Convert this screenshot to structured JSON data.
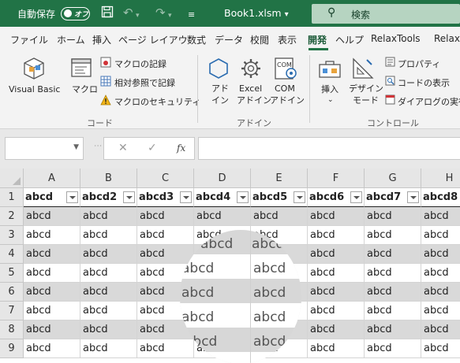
{
  "titlebar": {
    "autosave_label": "自動保存",
    "autosave_state": "オフ",
    "filename": "Book1.xlsm",
    "filename_chevron": "▾",
    "search_placeholder": "検索"
  },
  "tabs": [
    "ファイル",
    "ホーム",
    "挿入",
    "ページ レイアウ",
    "数式",
    "データ",
    "校閲",
    "表示",
    "開発",
    "ヘルプ",
    "RelaxTools",
    "Relax"
  ],
  "active_tab": "開発",
  "ribbon": {
    "code_group": {
      "label": "コード",
      "visual_basic": "Visual Basic",
      "macro": "マクロ",
      "record_macro": "マクロの記録",
      "relative_ref": "相対参照で記録",
      "macro_security": "マクロのセキュリティ"
    },
    "addin_group": {
      "label": "アドイン",
      "addin_line1": "アド",
      "addin_line2": "イン",
      "excel_addin_line1": "Excel",
      "excel_addin_line2": "アドイン",
      "com_addin_line1": "COM",
      "com_addin_line2": "アドイン"
    },
    "control_group": {
      "label": "コントロール",
      "insert": "挿入",
      "design_mode_line1": "デザイン",
      "design_mode_line2": "モード",
      "properties": "プロパティ",
      "view_code": "コードの表示",
      "run_dialog": "ダイアログの実行"
    }
  },
  "formula_bar": {
    "fx": "fx",
    "cancel": "✕",
    "enter": "✓",
    "formula": ""
  },
  "grid": {
    "columns": [
      "A",
      "B",
      "C",
      "D",
      "E",
      "F",
      "G",
      "H"
    ],
    "rows": [
      "1",
      "2",
      "3",
      "4",
      "5",
      "6",
      "7",
      "8",
      "9"
    ],
    "header_row": [
      "abcd",
      "abcd2",
      "abcd3",
      "abcd4",
      "abcd5",
      "abcd6",
      "abcd7",
      "abcd8"
    ],
    "cell_text": "abcd"
  },
  "colors": {
    "accent": "#217346",
    "band": "#d9d9d9"
  }
}
